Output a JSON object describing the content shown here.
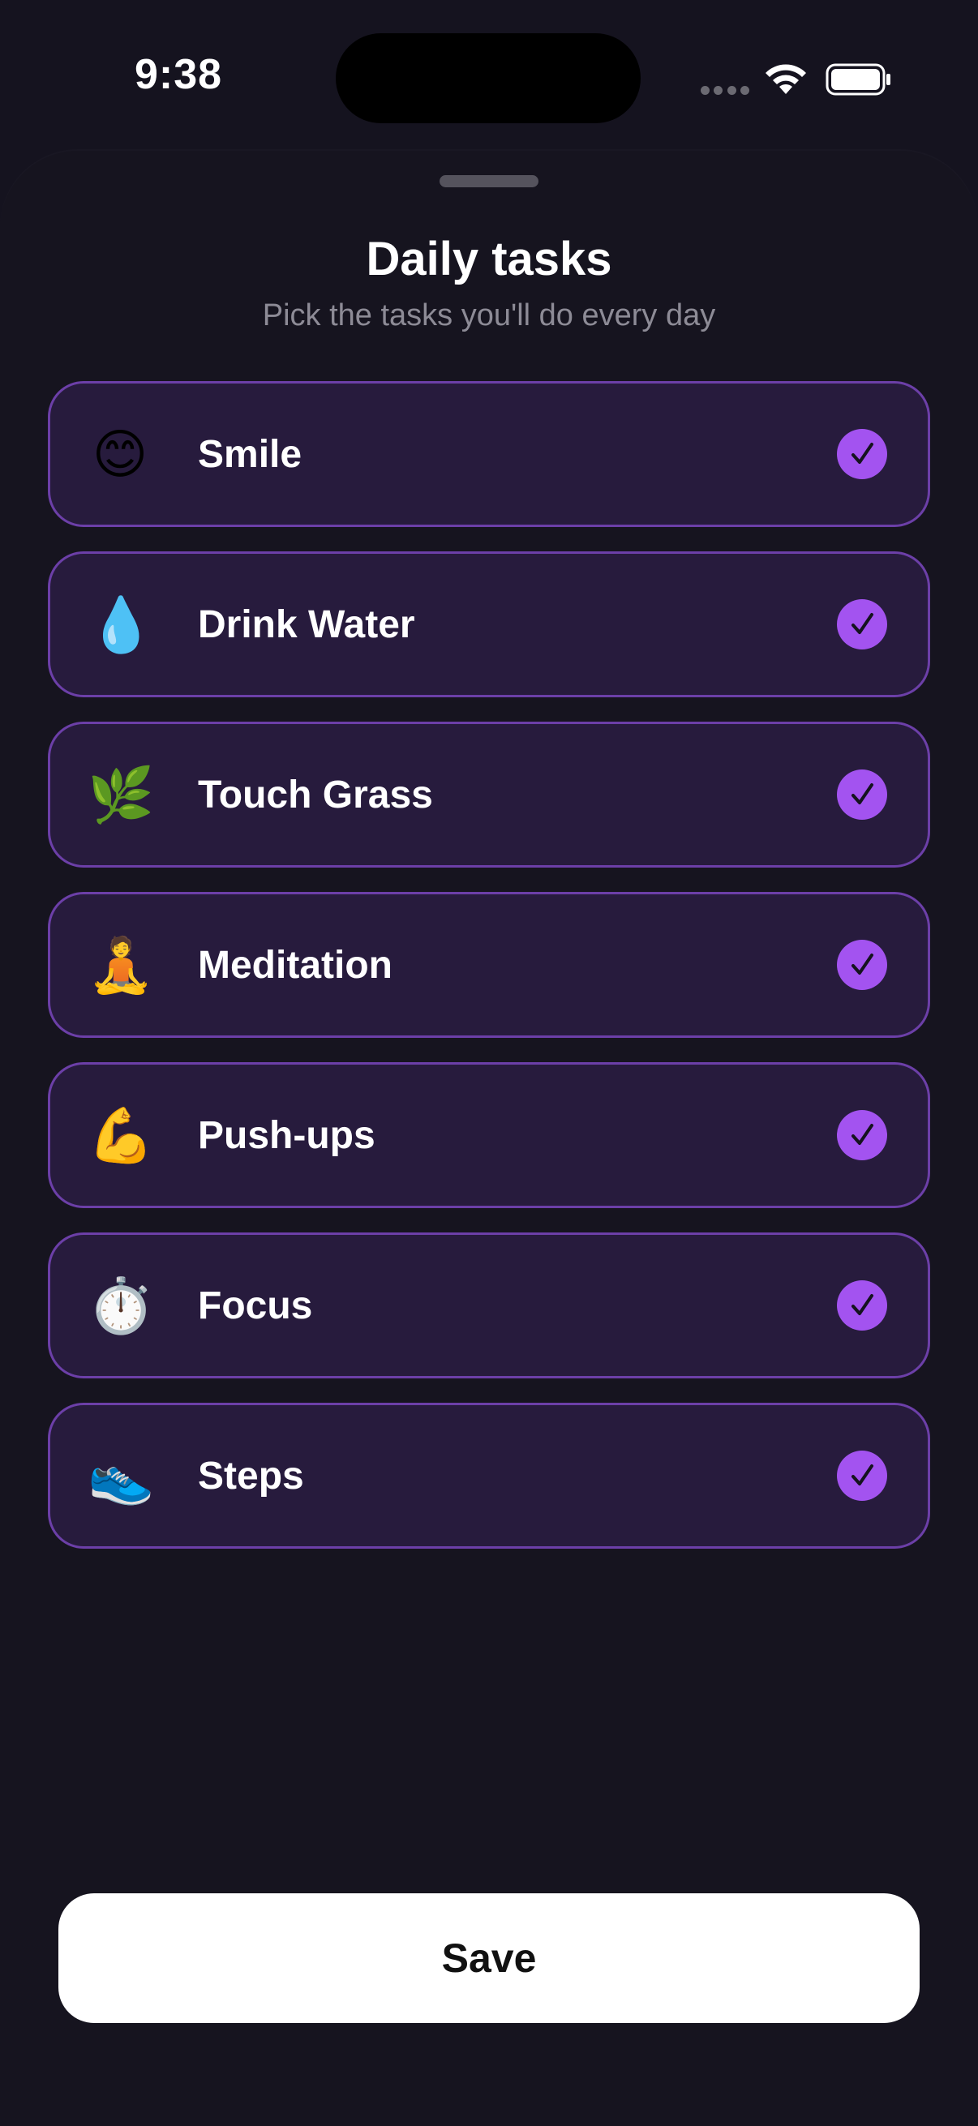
{
  "status_bar": {
    "time": "9:38",
    "icons": [
      "signal-dots-icon",
      "wifi-icon",
      "battery-icon"
    ]
  },
  "sheet": {
    "title": "Daily tasks",
    "subtitle": "Pick the tasks you'll do every day"
  },
  "tasks": [
    {
      "emoji": "😊",
      "icon": "smiling-face-icon",
      "label": "Smile",
      "checked": true
    },
    {
      "emoji": "💧",
      "icon": "water-droplet-icon",
      "label": "Drink Water",
      "checked": true
    },
    {
      "emoji": "🌿",
      "icon": "herb-icon",
      "label": "Touch Grass",
      "checked": true
    },
    {
      "emoji": "🧘",
      "icon": "meditating-person-icon",
      "label": "Meditation",
      "checked": true
    },
    {
      "emoji": "💪",
      "icon": "flexed-biceps-icon",
      "label": "Push-ups",
      "checked": true
    },
    {
      "emoji": "⏱️",
      "icon": "stopwatch-icon",
      "label": "Focus",
      "checked": true
    },
    {
      "emoji": "👟",
      "icon": "sneaker-icon",
      "label": "Steps",
      "checked": true
    }
  ],
  "save_label": "Save",
  "colors": {
    "background": "#15131f",
    "card": "#271b3d",
    "card_border": "#6c3fa8",
    "accent": "#a353f0",
    "button": "#ffffff"
  }
}
